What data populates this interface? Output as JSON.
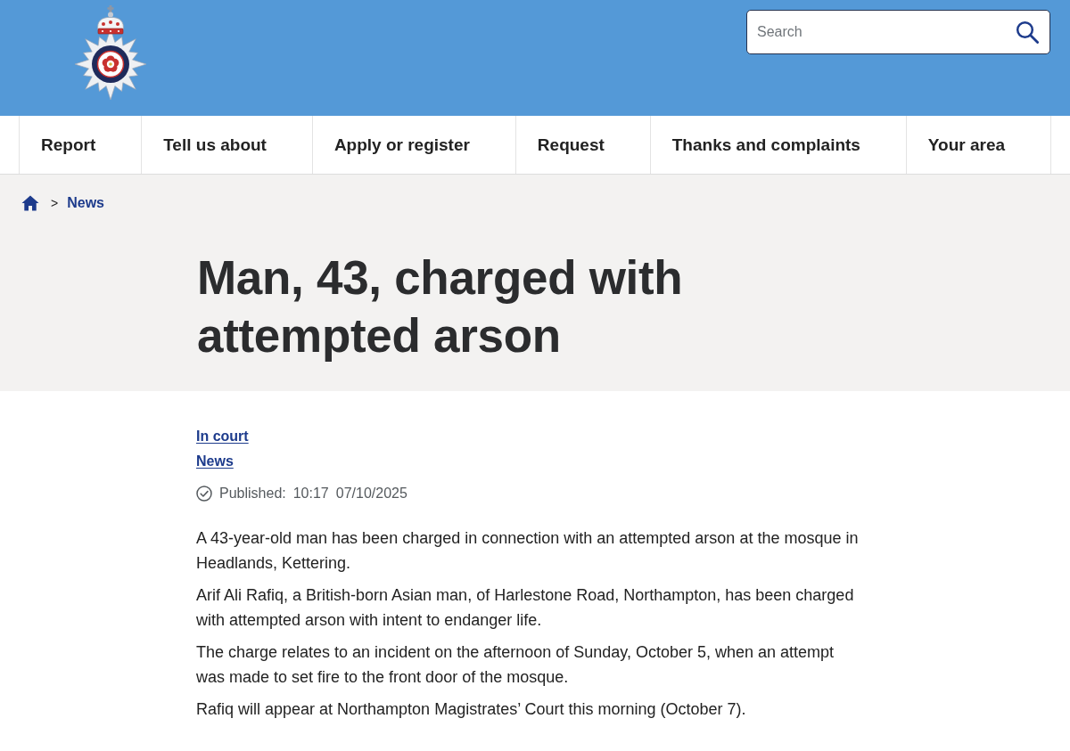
{
  "header": {
    "search": {
      "placeholder": "Search"
    }
  },
  "nav": {
    "items": [
      {
        "label": "Report"
      },
      {
        "label": "Tell us about"
      },
      {
        "label": "Apply or register"
      },
      {
        "label": "Request"
      },
      {
        "label": "Thanks and complaints"
      },
      {
        "label": "Your area"
      }
    ]
  },
  "breadcrumb": {
    "separator": ">",
    "items": [
      {
        "label": "News"
      }
    ]
  },
  "article": {
    "title": "Man, 43, charged with attempted arson",
    "tags": [
      "In court",
      "News"
    ],
    "published": {
      "label": "Published:",
      "time": "10:17",
      "date": "07/10/2025"
    },
    "paragraphs": [
      "A 43-year-old man has been charged in connection with an attempted arson at the mosque in Headlands, Kettering.",
      "Arif Ali Rafiq, a British-born Asian man, of Harlestone Road, Northampton, has been charged with attempted arson with intent to endanger life.",
      "The charge relates to an incident on the afternoon of Sunday, October 5, when an attempt was made to set fire to the front door of the mosque.",
      "Rafiq will appear at Northampton Magistrates’ Court this morning (October 7)."
    ]
  }
}
